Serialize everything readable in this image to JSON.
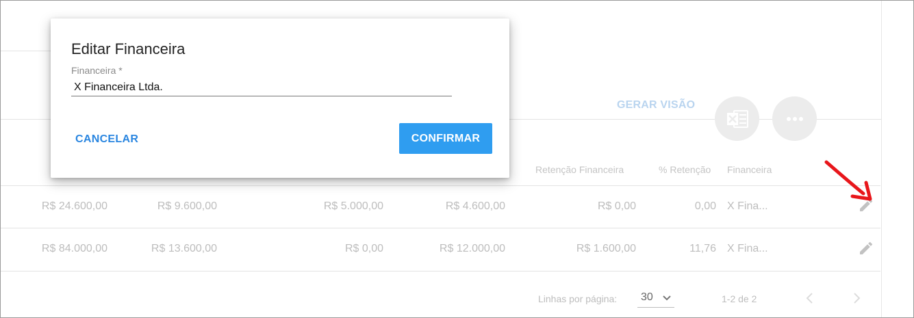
{
  "toolbar": {
    "gerar_visao": "GERAR VISÃO"
  },
  "table": {
    "headers": [
      "Retenção Financeira",
      "% Retenção",
      "Financeira"
    ],
    "rows": [
      [
        "R$ 24.600,00",
        "R$ 9.600,00",
        "R$ 5.000,00",
        "R$ 4.600,00",
        "R$ 0,00",
        "0,00",
        "X Fina..."
      ],
      [
        "R$ 84.000,00",
        "R$ 13.600,00",
        "R$ 0,00",
        "R$ 12.000,00",
        "R$ 1.600,00",
        "11,76",
        "X Fina..."
      ]
    ]
  },
  "pagination": {
    "rows_per_page_label": "Linhas por página:",
    "rows_per_page_value": "30",
    "range_label": "1-2 de 2"
  },
  "dialog": {
    "title": "Editar Financeira",
    "field_label": "Financeira *",
    "field_value": "X Financeira Ltda.",
    "cancel_label": "CANCELAR",
    "confirm_label": "CONFIRMAR"
  },
  "colors": {
    "accent": "#2f9df0",
    "link": "#2a86e0",
    "annotation_arrow": "#e8161b"
  },
  "icons": {
    "excel": "excel-icon",
    "more": "more-horizontal-icon",
    "edit": "pencil-icon",
    "prev": "chevron-left-icon",
    "next": "chevron-right-icon",
    "dropdown": "chevron-down-icon"
  }
}
